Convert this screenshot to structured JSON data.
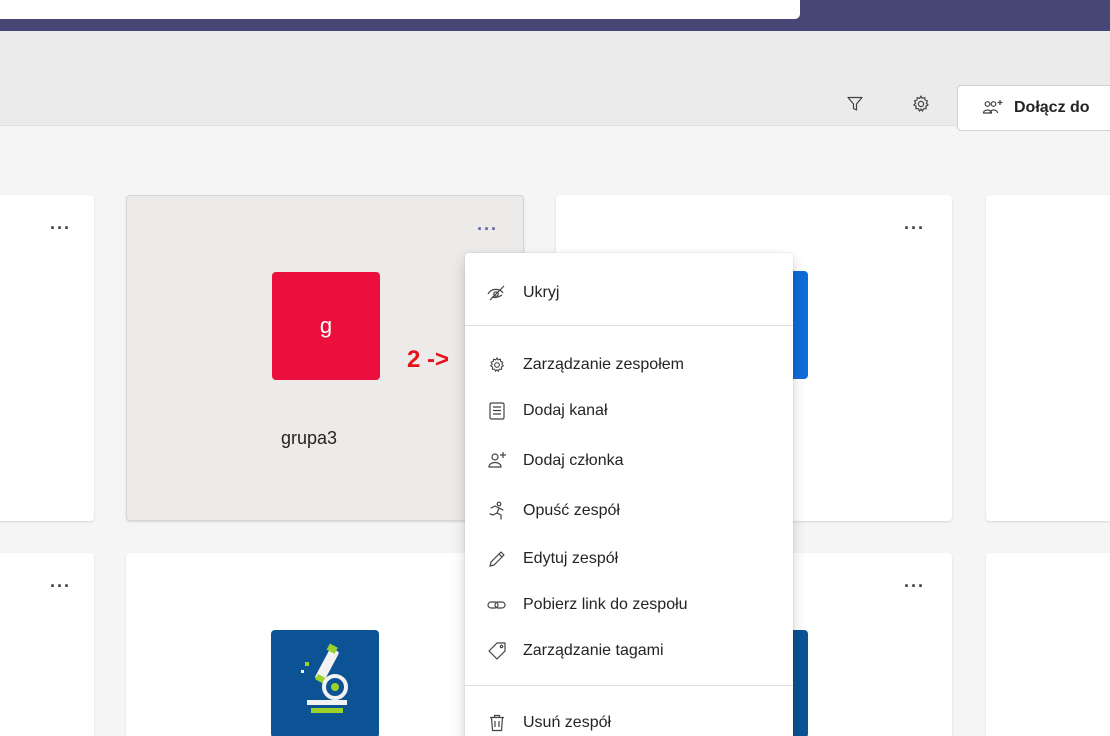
{
  "header": {
    "join_button_label": "Dołącz do"
  },
  "cards": {
    "card2": {
      "initial": "g",
      "name": "grupa3",
      "avatar_color": "#ea0f3d"
    },
    "card3": {
      "avatar_color": "#0f6cdb"
    },
    "card5": {
      "avatar_icon": "microscope-icon",
      "avatar_color": "#0b5394"
    },
    "card6": {
      "avatar_color": "#0b5394"
    }
  },
  "menu": {
    "hide": "Ukryj",
    "manage_team": "Zarządzanie zespołem",
    "add_channel": "Dodaj kanał",
    "add_member": "Dodaj członka",
    "leave_team": "Opuść zespół",
    "edit_team": "Edytuj zespół",
    "get_link": "Pobierz link do zespołu",
    "manage_tags": "Zarządzanie tagami",
    "delete_team": "Usuń zespół"
  },
  "annotation": {
    "text": "2 ->",
    "color": "#e8111b"
  },
  "colors": {
    "accent": "#6264a7",
    "titlebar": "#464775"
  }
}
